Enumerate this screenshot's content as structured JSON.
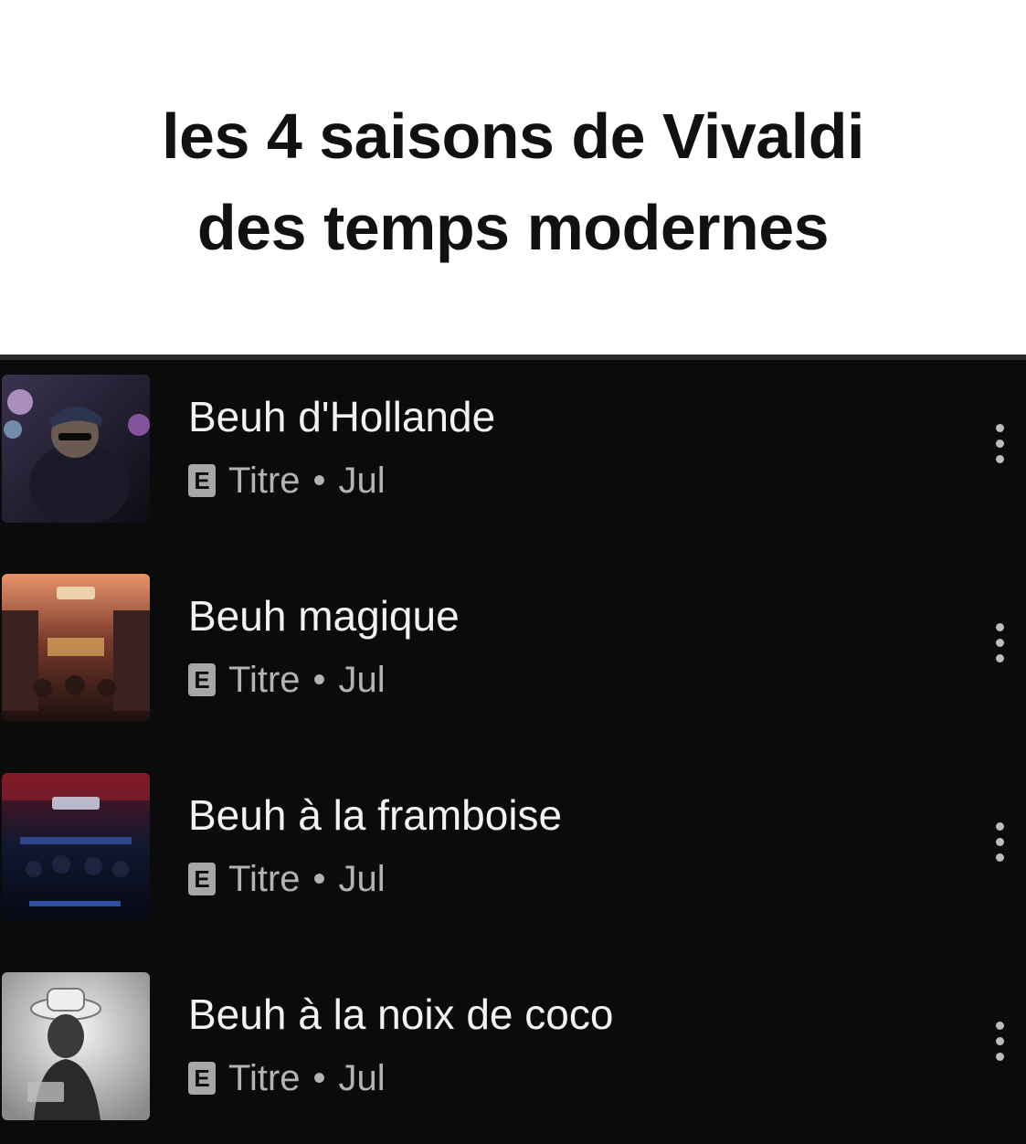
{
  "caption": {
    "line1": "les 4 saisons de Vivaldi",
    "line2": "des temps modernes"
  },
  "tracks": [
    {
      "title": "Beuh d'Hollande",
      "badge": "E",
      "type": "Titre",
      "separator": "•",
      "artist": "Jul",
      "cover_icon": "album-cover-portrait"
    },
    {
      "title": "Beuh magique",
      "badge": "E",
      "type": "Titre",
      "separator": "•",
      "artist": "Jul",
      "cover_icon": "album-cover-street"
    },
    {
      "title": "Beuh à la framboise",
      "badge": "E",
      "type": "Titre",
      "separator": "•",
      "artist": "Jul",
      "cover_icon": "album-cover-stage"
    },
    {
      "title": "Beuh à la noix de coco",
      "badge": "E",
      "type": "Titre",
      "separator": "•",
      "artist": "Jul",
      "cover_icon": "album-cover-portrait-hat"
    }
  ],
  "colors": {
    "background": "#0b0b0c",
    "title_text": "#f2f2f2",
    "meta_text": "#b3b3b3",
    "badge": "#a7a7a7"
  }
}
